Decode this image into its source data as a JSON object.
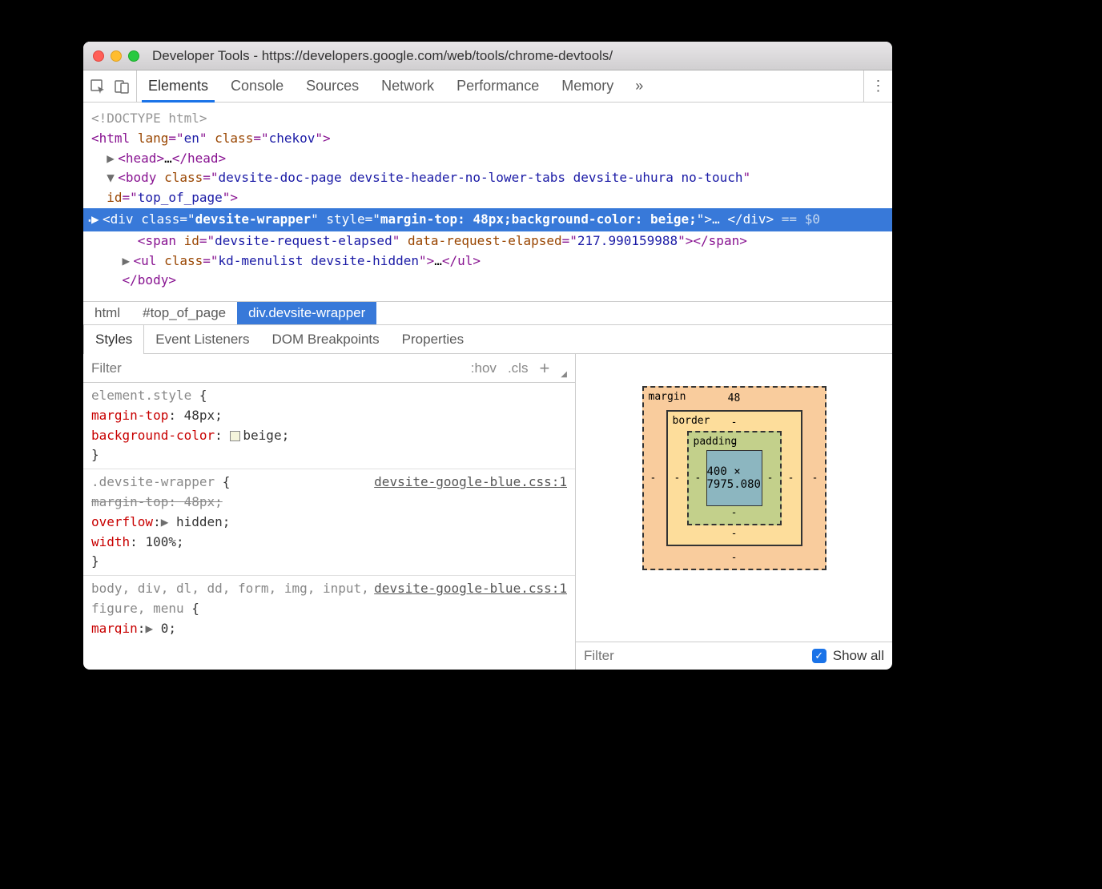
{
  "window": {
    "title": "Developer Tools - https://developers.google.com/web/tools/chrome-devtools/"
  },
  "tabs": [
    "Elements",
    "Console",
    "Sources",
    "Network",
    "Performance",
    "Memory"
  ],
  "active_tab": "Elements",
  "more_tabs_glyph": "»",
  "dom": {
    "doctype": "<!DOCTYPE html>",
    "html_open": {
      "lang": "en",
      "class": "chekov"
    },
    "head": {
      "ellipsis": "…"
    },
    "body_open": {
      "class": "devsite-doc-page devsite-header-no-lower-tabs devsite-uhura no-touch",
      "id": "top_of_page"
    },
    "selected_div": {
      "class": "devsite-wrapper",
      "style": "margin-top: 48px;background-color: beige;",
      "after": "== $0"
    },
    "span": {
      "id": "devsite-request-elapsed",
      "data_attr": "data-request-elapsed",
      "data_val": "217.990159988"
    },
    "ul": {
      "class": "kd-menulist devsite-hidden",
      "ellipsis": "…"
    },
    "body_close": "</body>"
  },
  "breadcrumb": [
    "html",
    "#top_of_page",
    "div.devsite-wrapper"
  ],
  "breadcrumb_selected": 2,
  "subtabs": [
    "Styles",
    "Event Listeners",
    "DOM Breakpoints",
    "Properties"
  ],
  "styles": {
    "filter_placeholder": "Filter",
    "hov": ":hov",
    "cls": ".cls",
    "rules": [
      {
        "selector": "element.style",
        "src": "",
        "decls": [
          {
            "prop": "margin-top",
            "val": "48px"
          },
          {
            "prop": "background-color",
            "val": "beige",
            "swatch": true
          }
        ]
      },
      {
        "selector": ".devsite-wrapper",
        "src": "devsite-google-blue.css:1",
        "decls": [
          {
            "prop": "margin-top",
            "val": "48px",
            "strike": true
          },
          {
            "prop": "overflow",
            "val": "hidden",
            "tri": true
          },
          {
            "prop": "width",
            "val": "100%"
          }
        ]
      },
      {
        "selector": "body, div, dl, dd, form, img, input, figure, menu",
        "src": "devsite-google-blue.css:1",
        "decls": [
          {
            "prop": "margin",
            "val": "0",
            "tri": true,
            "cut": true
          }
        ]
      }
    ]
  },
  "box_model": {
    "margin_label": "margin",
    "border_label": "border",
    "padding_label": "padding",
    "margin": {
      "top": "48",
      "right": "-",
      "bottom": "-",
      "left": "-"
    },
    "border": {
      "top": "-",
      "right": "-",
      "bottom": "-",
      "left": "-"
    },
    "padding": {
      "top": "-",
      "right": "-",
      "bottom": "-",
      "left": "-"
    },
    "content": "400 × 7975.080"
  },
  "computed_filter": {
    "placeholder": "Filter",
    "show_all": "Show all"
  }
}
